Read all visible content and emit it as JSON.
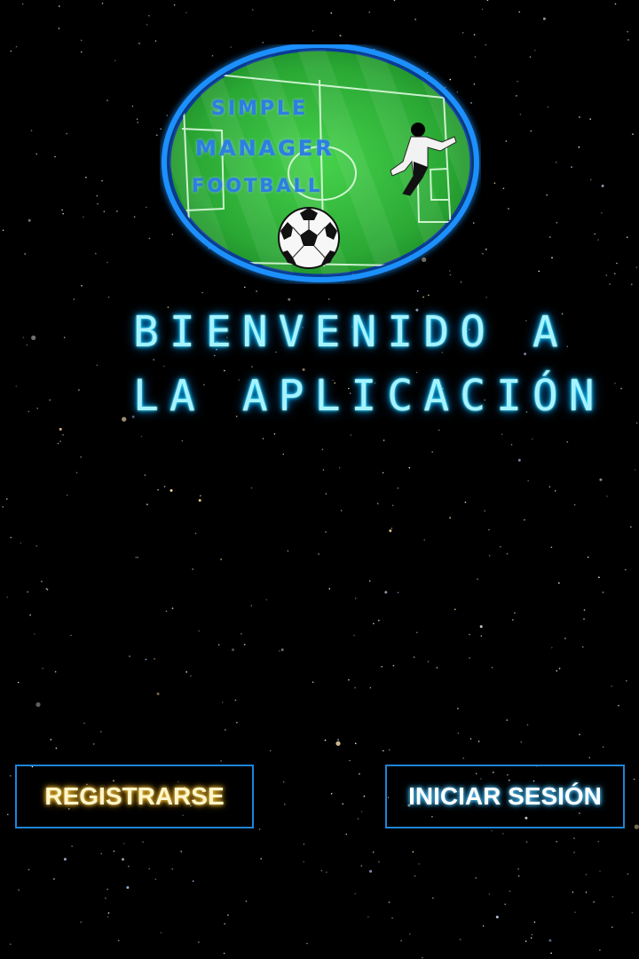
{
  "logo": {
    "line_1": "SIMPLE",
    "line_2": "MANAGER",
    "line_3": "FOOTBALL"
  },
  "welcome": {
    "line_1": "BIENVENIDO A",
    "line_2": "LA APLICACIÓN"
  },
  "buttons": {
    "register_label": "REGISTRARSE",
    "login_label": "INICIAR SESIÓN"
  },
  "colors": {
    "background": "#000000",
    "button_border": "#1e84d6",
    "welcome_text": "#a6f3ff",
    "register_text": "#fff6cc",
    "login_text": "#ffffff",
    "logo_ring": "#1e90ff",
    "pitch_green": "#2fbf3a"
  },
  "icons": {
    "logo_ball": "soccer-ball-icon",
    "logo_player": "player-silhouette-icon"
  }
}
